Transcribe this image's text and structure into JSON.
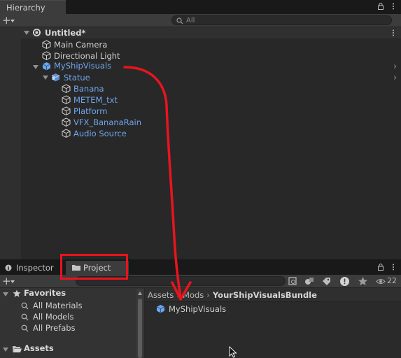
{
  "hierarchy": {
    "tab_label": "Hierarchy",
    "search_placeholder": "All",
    "scene_name": "Untitled*",
    "items": [
      {
        "label": "Main Camera",
        "kind": "gameobject"
      },
      {
        "label": "Directional Light",
        "kind": "gameobject"
      },
      {
        "label": "MyShipVisuals",
        "kind": "prefab"
      },
      {
        "label": "Statue",
        "kind": "prefab"
      },
      {
        "label": "Banana",
        "kind": "prefab"
      },
      {
        "label": "METEM_txt",
        "kind": "prefab"
      },
      {
        "label": "Platform",
        "kind": "prefab"
      },
      {
        "label": "VFX_BananaRain",
        "kind": "prefab"
      },
      {
        "label": "Audio Source",
        "kind": "prefab"
      }
    ]
  },
  "bottom_tabs": {
    "inspector_label": "Inspector",
    "project_label": "Project"
  },
  "project": {
    "hidden_count": "22",
    "favorites_label": "Favorites",
    "favorites": [
      "All Materials",
      "All Models",
      "All Prefabs"
    ],
    "assets_label": "Assets",
    "breadcrumb": [
      "Assets",
      "Mods",
      "YourShipVisualsBundle"
    ],
    "content_items": [
      {
        "label": "MyShipVisuals",
        "icon": "prefab-cube-icon"
      }
    ]
  },
  "colors": {
    "annotation": "#e8141e",
    "prefab_text": "#6fa5ed",
    "active_tab": "#3c3c3c"
  }
}
